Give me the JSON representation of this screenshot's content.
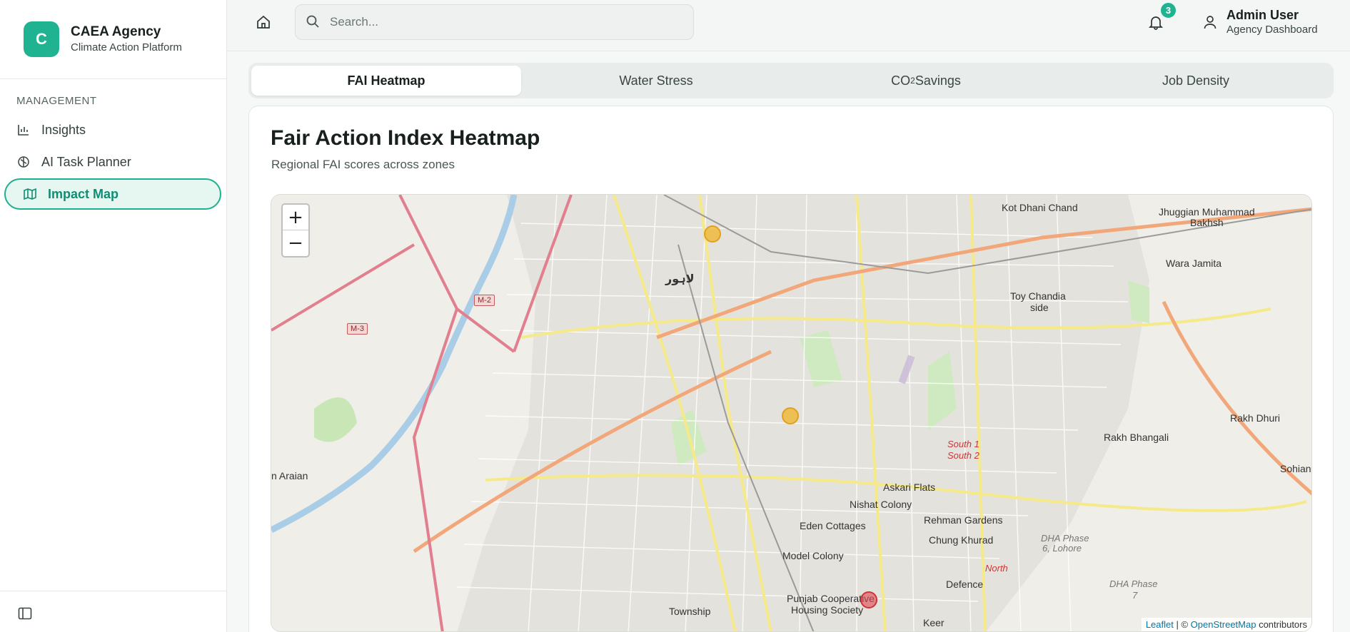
{
  "brand": {
    "logo_letter": "C",
    "title": "CAEA Agency",
    "subtitle": "Climate Action Platform",
    "accent": "#1fb391"
  },
  "sidebar": {
    "section_label": "MANAGEMENT",
    "items": [
      {
        "label": "Insights",
        "icon": "bar-chart-icon"
      },
      {
        "label": "AI Task Planner",
        "icon": "brain-icon"
      },
      {
        "label": "Impact Map",
        "icon": "map-icon",
        "active": true
      }
    ],
    "toggle_icon": "sidebar-toggle-icon"
  },
  "header": {
    "home_icon": "home-icon",
    "search_placeholder": "Search...",
    "notifications_count": "3",
    "user_name": "Admin User",
    "user_role": "Agency Dashboard"
  },
  "tabs": [
    {
      "label": "FAI Heatmap",
      "active": true
    },
    {
      "label": "Water Stress"
    },
    {
      "label": "CO",
      "sub": "2",
      "suffix": " Savings"
    },
    {
      "label": "Job Density"
    }
  ],
  "card": {
    "title": "Fair Action Index Heatmap",
    "subtitle": "Regional FAI scores across zones"
  },
  "map": {
    "zoom_in": "+",
    "zoom_out": "−",
    "attribution": {
      "leaflet": "Leaflet",
      "separator": " | © ",
      "osm": "OpenStreetMap",
      "suffix": " contributors"
    },
    "labels": {
      "kot_dhani": "Kot Dhani Chand",
      "jhuggian": "Jhuggian Muhammad",
      "bakhsh": "Bakhsh",
      "wara_jamita": "Wara Jamita",
      "toy_chandia": "Toy Chandia",
      "side": "side",
      "rakh_dhuri": "Rakh Dhuri",
      "rakh_bhangali": "Rakh Bhangali",
      "sohian": "Sohian K",
      "n_araian": "n Araian",
      "askari_flats": "Askari Flats",
      "nishat_colony": "Nishat Colony",
      "rehman_gardens": "Rehman Gardens",
      "eden_cottages": "Eden Cottages",
      "chung_khurad": "Chung Khurad",
      "model_colony": "Model Colony",
      "defence": "Defence",
      "punjab_coop": "Punjab Cooperative",
      "housing_society": "Housing Society",
      "township": "Township",
      "keer": "Keer",
      "south1": "South 1",
      "south2": "South 2",
      "north": "North",
      "dha_phase6": "DHA Phase",
      "dha_phase6b": "6, Lohore",
      "dha_phase7": "DHA Phase",
      "dha_phase7b": "7",
      "lahore_ur": "لاہور",
      "m2": "M-2",
      "m3": "M-3"
    },
    "markers": [
      {
        "color": "#f0b429",
        "label": "yellow-marker"
      },
      {
        "color": "#f0b429",
        "label": "yellow-marker"
      },
      {
        "color": "#e0474c",
        "label": "red-marker"
      }
    ]
  }
}
